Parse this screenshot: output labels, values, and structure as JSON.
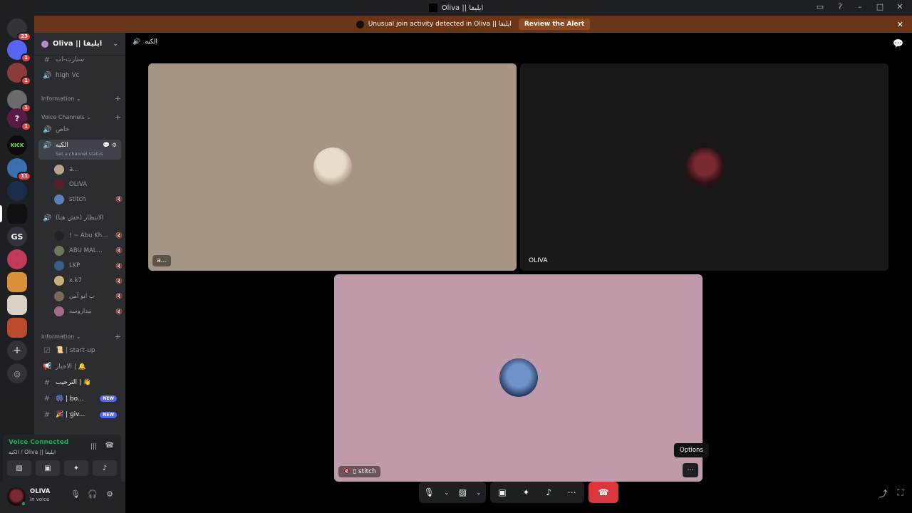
{
  "window": {
    "title": "Oliva || ايليفا"
  },
  "alert": {
    "message": "Unusual join activity detected in Oliva || ايليفا",
    "button": "Review the Alert"
  },
  "guilds": [
    {
      "label": "",
      "badge": "23",
      "color": "#313338"
    },
    {
      "label": "",
      "badge": "1",
      "color": "#5865f2"
    },
    {
      "label": "",
      "badge": "1",
      "color": "#8c3b3b"
    },
    {
      "label": "",
      "badge": "1",
      "color": "#6b6b6b"
    },
    {
      "label": "?",
      "badge": "1",
      "color": "#5a1a48"
    },
    {
      "label": "KICK",
      "badge": "",
      "color": "#0b0b0b"
    },
    {
      "label": "",
      "badge": "11",
      "color": "#3a6fb0"
    },
    {
      "label": "",
      "badge": "",
      "color": "#1b2b4a"
    },
    {
      "label": "",
      "badge": "",
      "color": "#111"
    },
    {
      "label": "GS",
      "badge": "",
      "color": "#313338"
    },
    {
      "label": "",
      "badge": "",
      "color": "#c23a5a"
    },
    {
      "label": "",
      "badge": "",
      "color": "#d8903a"
    },
    {
      "label": "",
      "badge": "",
      "color": "#d9d2c6"
    },
    {
      "label": "",
      "badge": "",
      "color": "#b94a2a"
    }
  ],
  "server": {
    "name": "Oliva || ايليفا"
  },
  "channels": {
    "top1": "ستارت-اب",
    "top2": "high Vc",
    "cat_information": "Information",
    "cat_voice": "Voice Channels",
    "vc_private": "خاص",
    "vc_active": "الكيه",
    "vc_status_hint": "Set a channel status",
    "vc_active_users": [
      {
        "name": "a...",
        "color": "#b8a58c"
      },
      {
        "name": "OLIVA",
        "color": "#5a1f26"
      },
      {
        "name": "stitch",
        "color": "#5c7db8"
      }
    ],
    "vc_waiting": "الانتظار (خش هنا)",
    "vc_waiting_users": [
      {
        "name": "! ~ Abu Kh...",
        "color": "#222"
      },
      {
        "name": "ABU MAL...",
        "color": "#6d7a5a"
      },
      {
        "name": "LKP",
        "color": "#3b5b8a"
      },
      {
        "name": "x.k7",
        "color": "#c9b07a"
      },
      {
        "name": "ب ابو آمن",
        "color": "#7a6a5a"
      },
      {
        "name": "بيداروسه",
        "color": "#a46a8a"
      }
    ],
    "cat_information2": "information",
    "text_channels": [
      {
        "icon": "☑",
        "label": "📜 | start-up",
        "badge": ""
      },
      {
        "icon": "📢",
        "label": "الاخبار | 🔔",
        "badge": ""
      },
      {
        "icon": "#",
        "label": "الترحيب | 👋",
        "badge": ""
      },
      {
        "icon": "#",
        "label": "🎆 | bo...",
        "badge": "NEW"
      },
      {
        "icon": "#",
        "label": "🎉 | giv...",
        "badge": "NEW"
      }
    ]
  },
  "voice_panel": {
    "status": "Voice Connected",
    "location": "الكيه / Oliva || ايليفا"
  },
  "user": {
    "name": "OLIVA",
    "status": "In voice"
  },
  "stage": {
    "channel_title": "الكيه",
    "tiles": [
      {
        "name": "a...",
        "bg": "#a69584"
      },
      {
        "name": "OLIVA",
        "bg": "#1a1718"
      },
      {
        "name": "stitch",
        "bg": "#c09aaa"
      }
    ],
    "tooltip": "Options"
  }
}
